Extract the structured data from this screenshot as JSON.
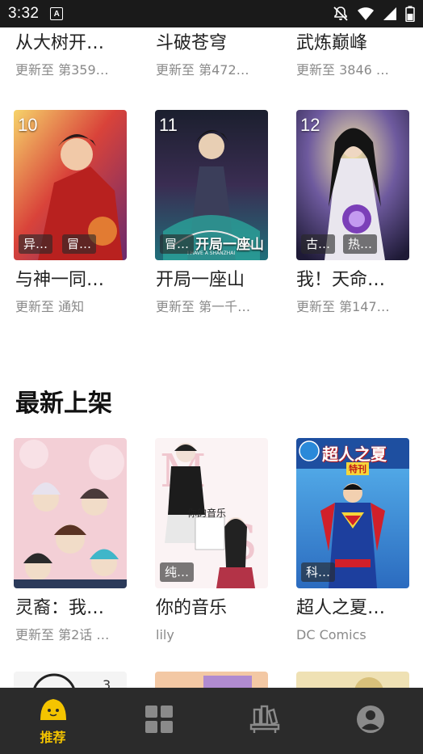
{
  "status": {
    "time": "3:32",
    "badge": "A"
  },
  "top_row": [
    {
      "title": "从大树开…",
      "sub": "更新至 第359…"
    },
    {
      "title": "斗破苍穹",
      "sub": "更新至 第472…"
    },
    {
      "title": "武炼巅峰",
      "sub": "更新至 3846 …"
    }
  ],
  "rank_row": [
    {
      "rank": "10",
      "tags": [
        "异…",
        "冒…"
      ],
      "title": "与神一同…",
      "sub": "更新至 通知"
    },
    {
      "rank": "11",
      "tags": [
        "冒…"
      ],
      "title": "开局一座山",
      "sub": "更新至 第一千…",
      "cover_text": "开局一座山",
      "cover_sub": "I HAVE A SHANZHAI"
    },
    {
      "rank": "12",
      "tags": [
        "古…",
        "热…"
      ],
      "title": "我！天命…",
      "sub": "更新至 第147…"
    }
  ],
  "section_new": {
    "title": "最新上架",
    "items": [
      {
        "tags": [],
        "title": "灵裔：我…",
        "sub": "更新至 第2话 …"
      },
      {
        "tags": [
          "纯…"
        ],
        "title": "你的音乐",
        "sub": "lily",
        "cover_text": "你的音乐"
      },
      {
        "tags": [
          "科…"
        ],
        "title": "超人之夏…",
        "sub": "DC Comics",
        "cover_text": "超人之夏",
        "cover_badge": "特刊"
      }
    ]
  },
  "bottom_nav": {
    "items": [
      {
        "label": "推荐",
        "icon": "recommend-icon",
        "active": true
      },
      {
        "label": "",
        "icon": "category-icon",
        "active": false
      },
      {
        "label": "",
        "icon": "bookshelf-icon",
        "active": false
      },
      {
        "label": "",
        "icon": "profile-icon",
        "active": false
      }
    ]
  },
  "colors": {
    "accent": "#f4c400",
    "nav_bg": "#2b2b2b",
    "status_bg": "#1a1a1a"
  }
}
